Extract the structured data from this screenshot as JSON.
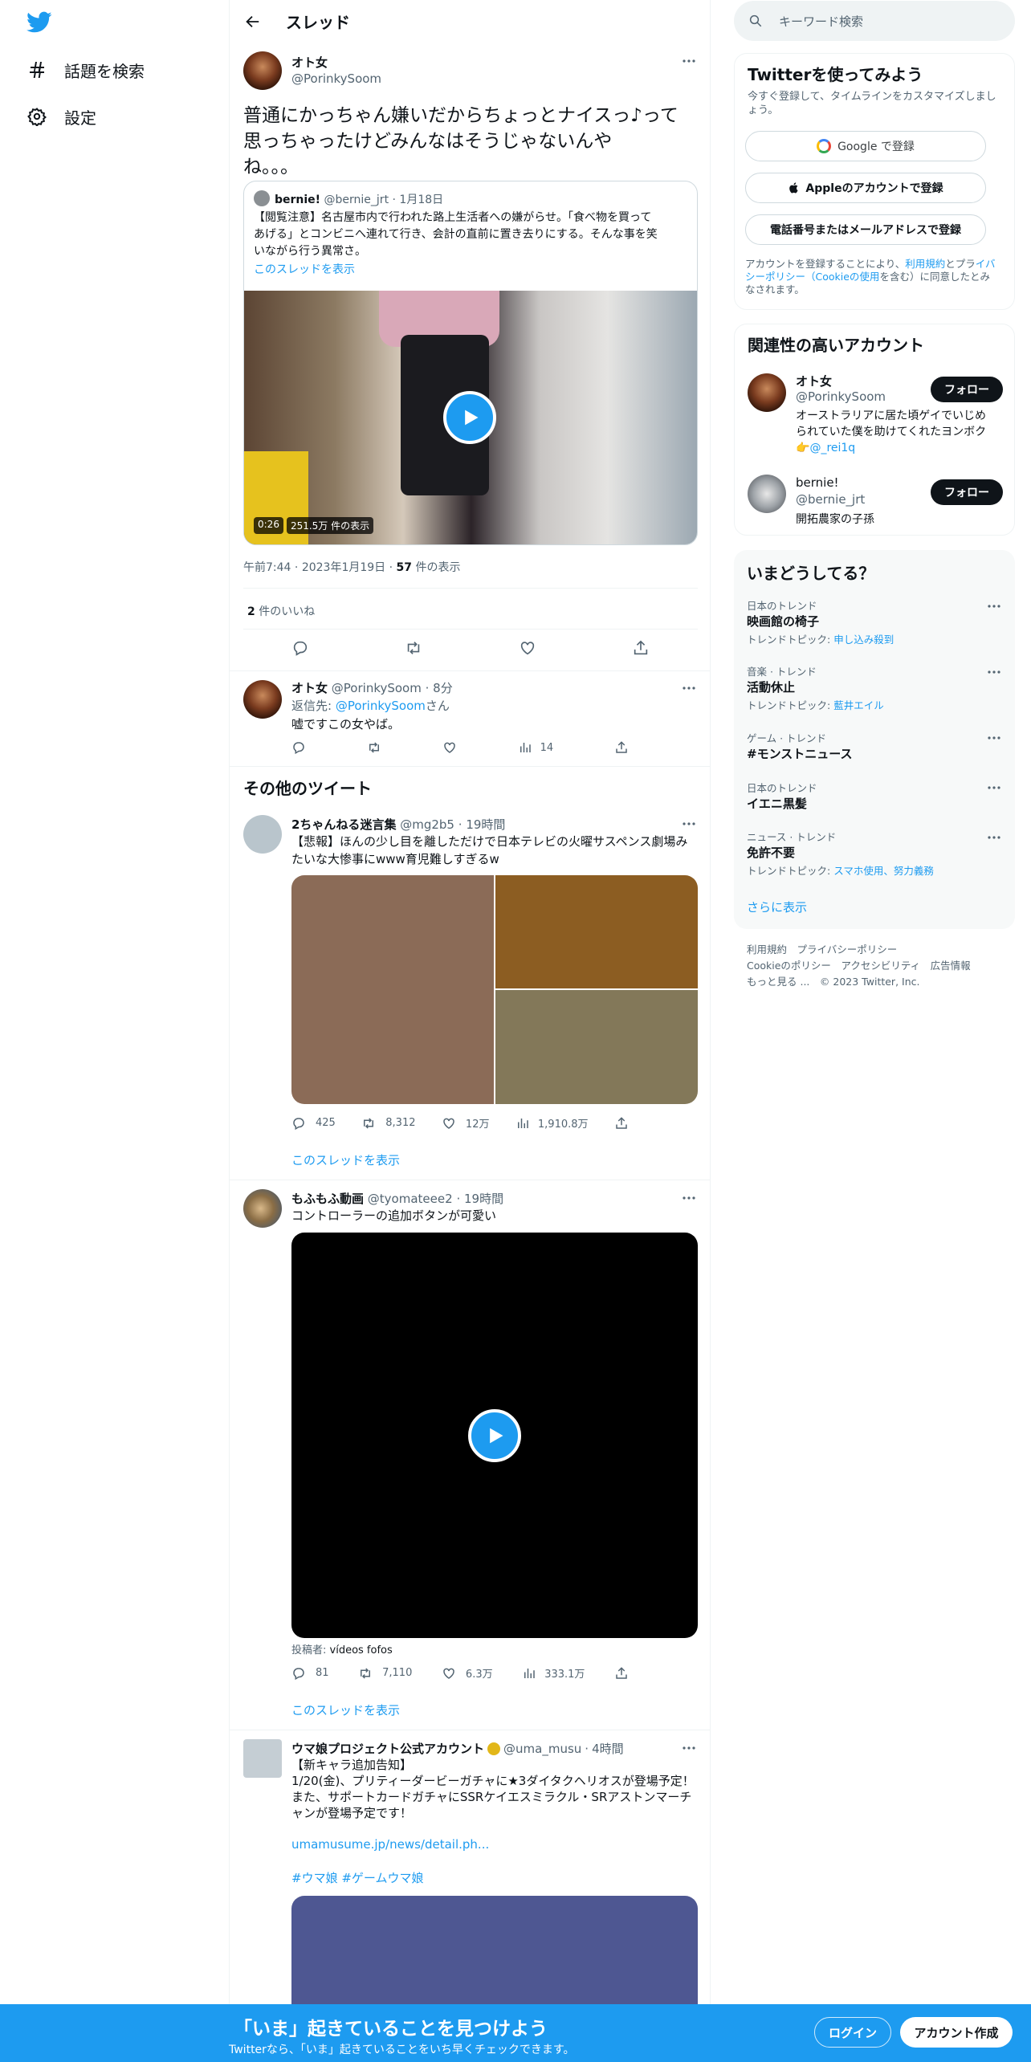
{
  "nav": {
    "explore_label": "話題を検索",
    "settings_label": "設定"
  },
  "header": {
    "title": "スレッド"
  },
  "main_tweet": {
    "name": "オト女",
    "handle": "@PorinkySoom",
    "text_lines": [
      "普通にかっちゃん嫌いだからちょっとナイスっ♪って",
      "思っちゃったけどみんなはそうじゃないんや",
      "ね。。。"
    ],
    "quote": {
      "name": "bernie!",
      "handle": "@bernie_jrt",
      "date": "1月18日",
      "text_lines": [
        "【閲覧注意】名古屋市内で行われた路上生活者への嫌がらせ。「食べ物を買って",
        "あげる」とコンビニへ連れて行き、会計の直前に置き去りにする。そんな事を笑",
        "いながら行う異常さ。"
      ],
      "show_thread": "このスレッドを表示",
      "video_duration": "0:26",
      "video_views": "251.5万 件の表示"
    },
    "time": "午前7:44",
    "date": "2023年1月19日",
    "views_count": "57",
    "views_label": "件の表示",
    "likes_count": "2",
    "likes_label": "件のいいね"
  },
  "reply": {
    "name": "オト女",
    "handle": "@PorinkySoom",
    "time": "8分",
    "reply_to_prefix": "返信先: ",
    "reply_to_handle": "@PorinkySoom",
    "reply_to_suffix": "さん",
    "text": "嘘ですこの女やば。",
    "views": "14"
  },
  "more_tweets_title": "その他のツイート",
  "more_tweets": [
    {
      "name": "2ちゃんねる迷言集",
      "handle": "@mg2b5",
      "time": "19時間",
      "text_lines": [
        "【悲報】ほんの少し目を離しただけで日本テレビの火曜サスペンス劇場み",
        "たいな大惨事にwww育児難しすぎるw"
      ],
      "replies": "425",
      "retweets": "8,312",
      "likes": "12万",
      "views": "1,910.8万",
      "show_thread": "このスレッドを表示"
    },
    {
      "name": "もふもふ動画",
      "handle": "@tyomateee2",
      "time": "19時間",
      "text": "コントローラーの追加ボタンが可愛い",
      "poster_prefix": "投稿者: ",
      "poster_name": "vídeos fofos",
      "replies": "81",
      "retweets": "7,110",
      "likes": "6.3万",
      "views": "333.1万",
      "show_thread": "このスレッドを表示"
    },
    {
      "name": "ウマ娘プロジェクト公式アカウント",
      "handle": "@uma_musu",
      "time": "4時間",
      "text_lines": [
        "【新キャラ追加告知】",
        "1/20(金)、プリティーダービーガチャに★3ダイタクヘリオスが登場予定！",
        "また、サポートカードガチャにSSRケイエスミラクル・SRアストンマーチ",
        "ャンが登場予定です！"
      ],
      "link": "umamusume.jp/news/detail.ph...",
      "hashtags": "#ウマ娘 #ゲームウマ娘"
    }
  ],
  "search": {
    "placeholder": "キーワード検索"
  },
  "signup": {
    "title": "Twitterを使ってみよう",
    "subtitle_lines": [
      "今すぐ登録して、タイムラインをカスタマイズしまし",
      "ょう。"
    ],
    "google_label": "Google で登録",
    "apple_label": "Appleのアカウントで登録",
    "phone_label": "電話番号またはメールアドレスで登録",
    "legal_prefix": "アカウントを登録することにより、",
    "legal_terms": "利用規約",
    "legal_and": "とプラ",
    "legal_privacy": "イバシーポリシー（Cookieの使用",
    "legal_suffix": "を含む）に同意したと",
    "legal_end": "みなされます。"
  },
  "relevant": {
    "title": "関連性の高いアカウント",
    "accounts": [
      {
        "name": "オト女",
        "handle": "@PorinkySoom",
        "bio_lines": [
          "オーストラリアに居た頃ゲイでいじめ",
          "られていた僕を助けてくれたヨンボク"
        ],
        "bio_mention": "@_rei1q",
        "follow": "フォロー"
      },
      {
        "name": "bernie!",
        "handle": "@bernie_jrt",
        "bio": "開拓農家の子孫",
        "follow": "フォロー"
      }
    ]
  },
  "trends": {
    "title": "いまどうしてる？",
    "items": [
      {
        "context": "日本のトレンド",
        "name": "映画館の椅子",
        "topic_prefix": "トレンドトピック: ",
        "topic": "申し込み殺到"
      },
      {
        "context": "音楽 · トレンド",
        "name": "活動休止",
        "topic_prefix": "トレンドトピック: ",
        "topic": "藍井エイル"
      },
      {
        "context": "ゲーム · トレンド",
        "name": "#モンストニュース"
      },
      {
        "context": "日本のトレンド",
        "name": "イエニ黒髪"
      },
      {
        "context": "ニュース · トレンド",
        "name": "免許不要",
        "topic_prefix": "トレンドトピック: ",
        "topic": "スマホ使用、努力義務"
      }
    ],
    "show_more": "さらに表示"
  },
  "footer": {
    "terms": "利用規約",
    "privacy": "プライバシーポリシー",
    "cookie": "Cookieのポリシー",
    "accessibility": "アクセシビリティ",
    "ads": "広告情報",
    "more": "もっと見る ...",
    "copyright": "© 2023 Twitter, Inc."
  },
  "bottom_bar": {
    "title": "「いま」起きていることを見つけよう",
    "subtitle": "Twitterなら、「いま」起きていることをいち早くチェックできます。",
    "login": "ログイン",
    "signup": "アカウント作成"
  },
  "colors": {
    "accent": "#1d9bf0",
    "text": "#0f1419",
    "muted": "#536471",
    "dark_button": "#0f1419"
  }
}
